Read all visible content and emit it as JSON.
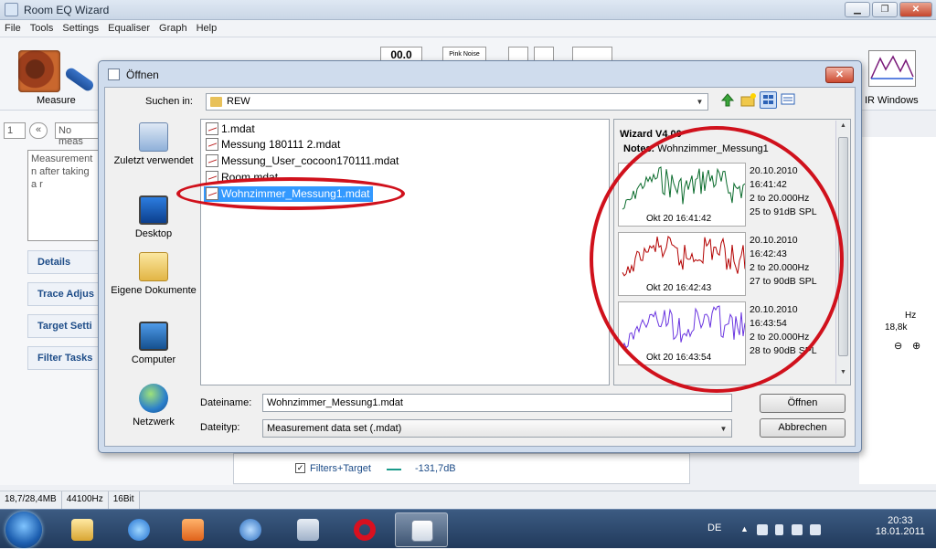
{
  "main_window": {
    "title": "Room EQ Wizard",
    "menu": [
      "File",
      "Tools",
      "Settings",
      "Equaliser",
      "Graph",
      "Help"
    ],
    "toolbar": {
      "measure_label": "Measure",
      "meter_readout": "00.0",
      "generator_label": "Pink Noise",
      "ir_windows_label": "IR Windows"
    },
    "left_panel": {
      "measurement_index": "1",
      "measurement_name_placeholder": "No meas",
      "notes_text": "Measurement n after taking a r",
      "tabs": [
        "Details",
        "Trace Adjus",
        "Target Setti",
        "Filter Tasks"
      ]
    },
    "graph": {
      "x_unit": "Hz",
      "x_tick": "18,8k",
      "legend_item": "Filters+Target",
      "legend_value": "-131,7dB"
    },
    "statusbar": [
      "18,7/28,4MB",
      "44100Hz",
      "16Bit"
    ]
  },
  "dialog": {
    "title": "Öffnen",
    "look_in_label": "Suchen in:",
    "current_folder": "REW",
    "places": [
      {
        "label": "Zuletzt verwendet",
        "icon": "recent-places-icon"
      },
      {
        "label": "Desktop",
        "icon": "desktop-icon"
      },
      {
        "label": "Eigene Dokumente",
        "icon": "documents-folder-icon"
      },
      {
        "label": "Computer",
        "icon": "computer-icon"
      },
      {
        "label": "Netzwerk",
        "icon": "network-icon"
      }
    ],
    "files": [
      {
        "name": "1.mdat",
        "selected": false
      },
      {
        "name": "Messung 180111 2.mdat",
        "selected": false
      },
      {
        "name": "Messung_User_cocoon170111.mdat",
        "selected": false
      },
      {
        "name": "Room.mdat",
        "selected": false
      },
      {
        "name": "Wohnzimmer_Messung1.mdat",
        "selected": true
      }
    ],
    "preview": {
      "title": "Wizard V4,00",
      "notes_label": "Notes:",
      "notes_value": "Wohnzimmer_Messung1",
      "measurements": [
        {
          "thumb_label": "Okt 20 16:41:42",
          "date": "20.10.2010",
          "time": "16:41:42",
          "range": "2 to 20.000Hz",
          "spl": "25 to 91dB SPL",
          "color": "#0a6b2c"
        },
        {
          "thumb_label": "Okt 20 16:42:43",
          "date": "20.10.2010",
          "time": "16:42:43",
          "range": "2 to 20.000Hz",
          "spl": "27 to 90dB SPL",
          "color": "#b30000"
        },
        {
          "thumb_label": "Okt 20 16:43:54",
          "date": "20.10.2010",
          "time": "16:43:54",
          "range": "2 to 20.000Hz",
          "spl": "28 to 90dB SPL",
          "color": "#6a35e0"
        }
      ]
    },
    "filename_label": "Dateiname:",
    "filename_value": "Wohnzimmer_Messung1.mdat",
    "filetype_label": "Dateityp:",
    "filetype_value": "Measurement data set (.mdat)",
    "open_button": "Öffnen",
    "cancel_button": "Abbrechen"
  },
  "taskbar": {
    "language": "DE",
    "time": "20:33",
    "date": "18.01.2011"
  },
  "annotation_color": "#d0111c"
}
